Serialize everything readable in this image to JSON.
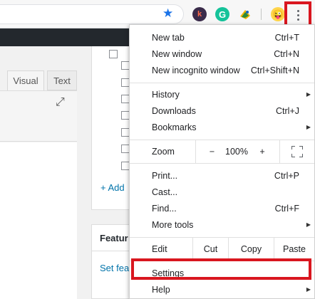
{
  "toolbar": {
    "extensions": [
      {
        "name": "k-extension-icon",
        "glyph": "k"
      },
      {
        "name": "grammarly-icon",
        "glyph": "G"
      },
      {
        "name": "bird-extension-icon",
        "glyph": ""
      },
      {
        "name": "emoji-extension-icon",
        "glyph": "😜"
      }
    ]
  },
  "editor": {
    "tab_visual": "Visual",
    "tab_text": "Text",
    "add_link": "+ Add",
    "featured_title": "Featur",
    "featured_link": "Set fea"
  },
  "menu": {
    "new_tab": {
      "label": "New tab",
      "shortcut": "Ctrl+T"
    },
    "new_window": {
      "label": "New window",
      "shortcut": "Ctrl+N"
    },
    "new_incognito": {
      "label": "New incognito window",
      "shortcut": "Ctrl+Shift+N"
    },
    "history": {
      "label": "History"
    },
    "downloads": {
      "label": "Downloads",
      "shortcut": "Ctrl+J"
    },
    "bookmarks": {
      "label": "Bookmarks"
    },
    "zoom": {
      "label": "Zoom",
      "minus": "−",
      "value": "100%",
      "plus": "+"
    },
    "print": {
      "label": "Print...",
      "shortcut": "Ctrl+P"
    },
    "cast": {
      "label": "Cast..."
    },
    "find": {
      "label": "Find...",
      "shortcut": "Ctrl+F"
    },
    "more_tools": {
      "label": "More tools"
    },
    "edit": {
      "label": "Edit",
      "cut": "Cut",
      "copy": "Copy",
      "paste": "Paste"
    },
    "settings": {
      "label": "Settings"
    },
    "help": {
      "label": "Help"
    }
  },
  "colors": {
    "highlight": "#d9161f",
    "link": "#0073aa",
    "star": "#1a73e8"
  }
}
